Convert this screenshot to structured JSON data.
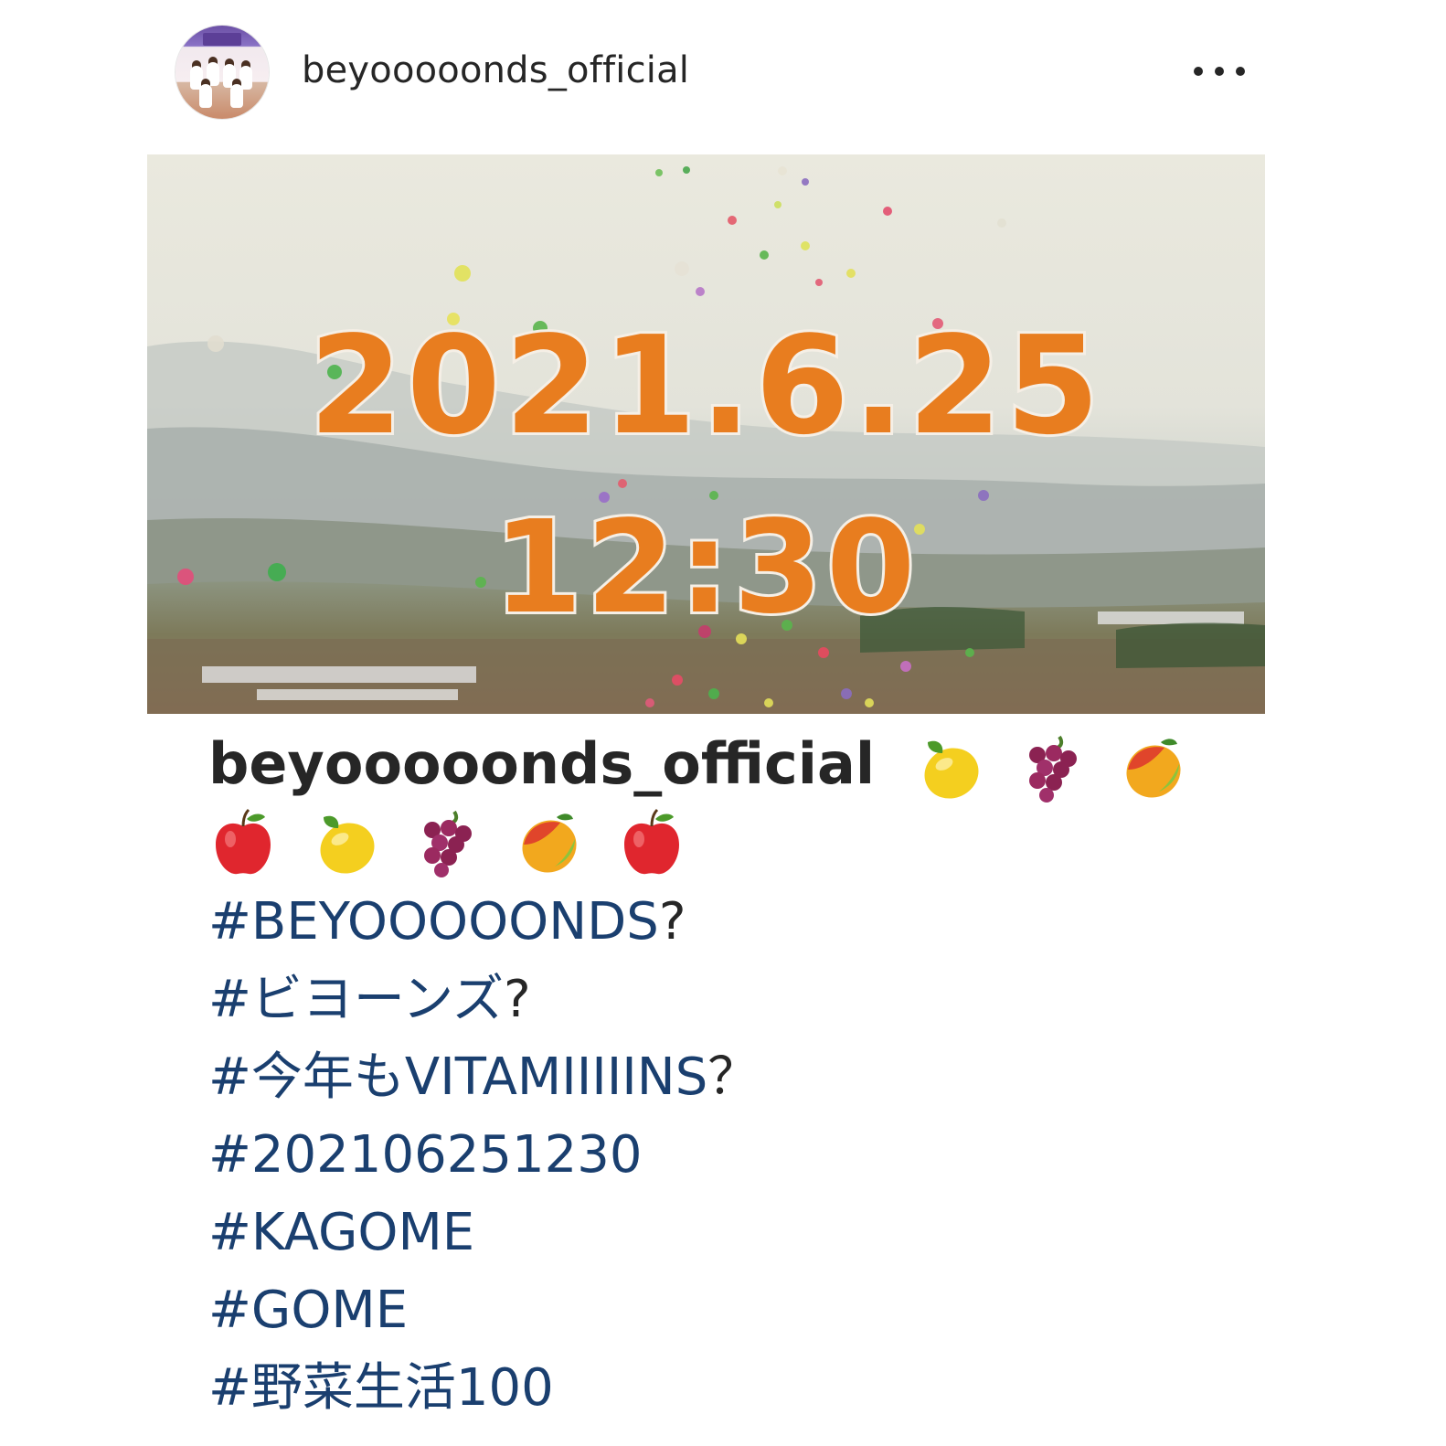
{
  "header": {
    "username": "beyooooonds_official",
    "more_icon": "more-dots-icon"
  },
  "post_image": {
    "date_text": "2021.6.25",
    "time_text": "12:30",
    "overlay_color": "#e87d1f"
  },
  "caption": {
    "username": "beyooooonds_official",
    "emojis": [
      "lemon-emoji",
      "grapes-emoji",
      "mango-emoji",
      "red-apple-emoji",
      "lemon-emoji",
      "grapes-emoji",
      "mango-emoji",
      "red-apple-emoji"
    ],
    "hashtags": [
      {
        "tag": "#BEYOOOOONDS",
        "suffix": "?"
      },
      {
        "tag": "#ビヨーンズ",
        "suffix": "?"
      },
      {
        "tag": "#今年もVITAMIIIIINS",
        "suffix": "？"
      },
      {
        "tag": "#202106251230",
        "suffix": ""
      },
      {
        "tag": "#KAGOME",
        "suffix": ""
      },
      {
        "tag": "#GOME",
        "suffix": ""
      },
      {
        "tag": "#野菜生活100",
        "suffix": ""
      }
    ]
  },
  "colors": {
    "text": "#262626",
    "hashtag": "#1a3f6f"
  }
}
